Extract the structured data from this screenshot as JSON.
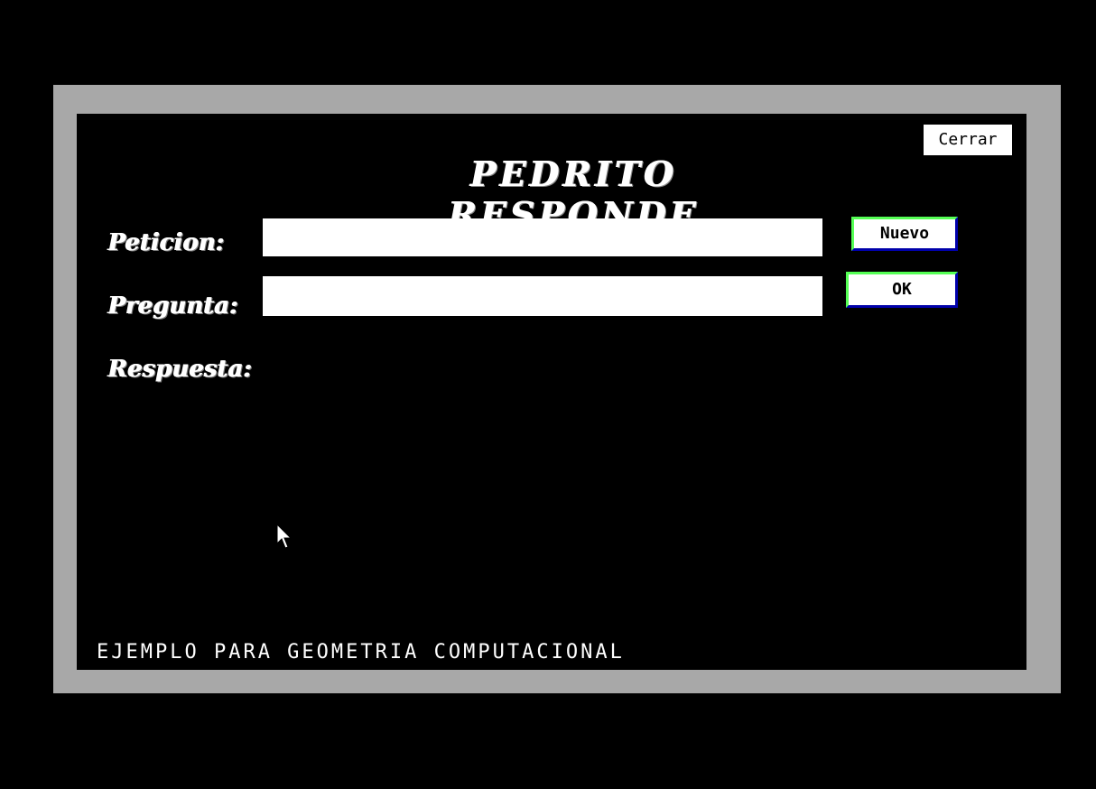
{
  "window": {
    "title": "PEDRITO RESPONDE",
    "close_label": "Cerrar"
  },
  "form": {
    "peticion_label": "Peticion:",
    "peticion_value": "",
    "pregunta_label": "Pregunta:",
    "pregunta_value": "",
    "respuesta_label": "Respuesta:"
  },
  "buttons": {
    "nuevo_label": "Nuevo",
    "ok_label": "OK"
  },
  "footer": {
    "text": "EJEMPLO PARA GEOMETRIA COMPUTACIONAL"
  },
  "colors": {
    "frame": "#a8a8a8",
    "background": "#000000",
    "button_highlight": "#55ff55",
    "button_shadow": "#0000aa"
  },
  "icons": {
    "cursor": "mouse-pointer-icon"
  }
}
